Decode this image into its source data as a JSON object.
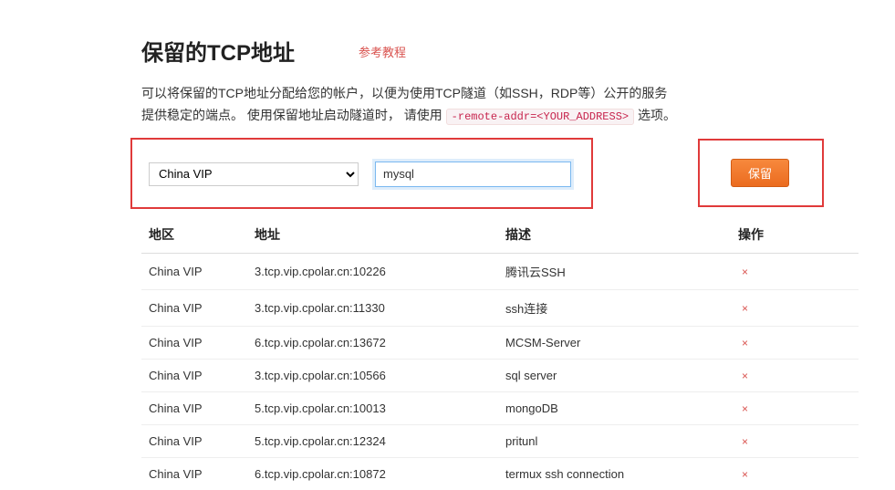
{
  "header": {
    "title": "保留的TCP地址",
    "tutorial_link": "参考教程"
  },
  "description": {
    "line1": "可以将保留的TCP地址分配给您的帐户，以便为使用TCP隧道（如SSH，RDP等）公开的服务",
    "line2_prefix": "提供稳定的端点。 使用保留地址启动隧道时， 请使用 ",
    "code": "-remote-addr=<YOUR_ADDRESS>",
    "line2_suffix": " 选项。"
  },
  "form": {
    "region_selected": "China VIP",
    "desc_value": "mysql",
    "reserve_label": "保留"
  },
  "table": {
    "headers": {
      "region": "地区",
      "address": "地址",
      "description": "描述",
      "action": "操作"
    },
    "rows": [
      {
        "region": "China VIP",
        "address": "3.tcp.vip.cpolar.cn:10226",
        "description": "腾讯云SSH"
      },
      {
        "region": "China VIP",
        "address": "3.tcp.vip.cpolar.cn:11330",
        "description": "ssh连接"
      },
      {
        "region": "China VIP",
        "address": "6.tcp.vip.cpolar.cn:13672",
        "description": "MCSM-Server"
      },
      {
        "region": "China VIP",
        "address": "3.tcp.vip.cpolar.cn:10566",
        "description": "sql server"
      },
      {
        "region": "China VIP",
        "address": "5.tcp.vip.cpolar.cn:10013",
        "description": "mongoDB"
      },
      {
        "region": "China VIP",
        "address": "5.tcp.vip.cpolar.cn:12324",
        "description": "pritunl"
      },
      {
        "region": "China VIP",
        "address": "6.tcp.vip.cpolar.cn:10872",
        "description": "termux ssh connection"
      }
    ],
    "delete_label": "×"
  }
}
